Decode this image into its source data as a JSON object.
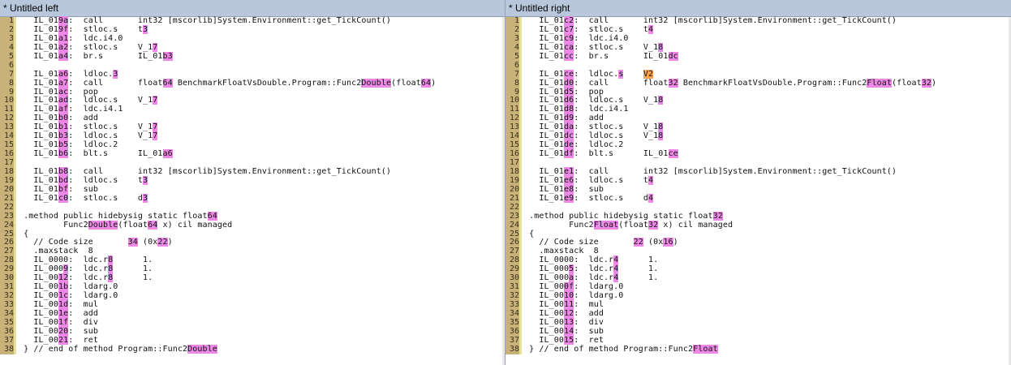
{
  "panes": [
    {
      "title": "* Untitled left",
      "lines": [
        [
          [
            "   IL_01",
            ""
          ],
          [
            "9a",
            "hl"
          ],
          [
            ":  call       int32 [mscorlib]System.Environment::get_TickCount()",
            ""
          ]
        ],
        [
          [
            "   IL_01",
            ""
          ],
          [
            "9f",
            "hl"
          ],
          [
            ":  stloc.s    t",
            ""
          ],
          [
            "3",
            "hl"
          ]
        ],
        [
          [
            "   IL_01",
            ""
          ],
          [
            "a1",
            "hl"
          ],
          [
            ":  ldc.i4.0",
            ""
          ]
        ],
        [
          [
            "   IL_01",
            ""
          ],
          [
            "a2",
            "hl"
          ],
          [
            ":  stloc.s    V_1",
            ""
          ],
          [
            "7",
            "hl"
          ]
        ],
        [
          [
            "   IL_01",
            ""
          ],
          [
            "a4",
            "hl"
          ],
          [
            ":  br.s       IL_01",
            ""
          ],
          [
            "b3",
            "hl"
          ]
        ],
        [
          [
            "",
            ""
          ]
        ],
        [
          [
            "   IL_01",
            ""
          ],
          [
            "a6",
            "hl"
          ],
          [
            ":  ldloc.",
            ""
          ],
          [
            "3",
            "hl"
          ]
        ],
        [
          [
            "   IL_01",
            ""
          ],
          [
            "a7",
            "hl"
          ],
          [
            ":  call       float",
            ""
          ],
          [
            "64",
            "hl"
          ],
          [
            " BenchmarkFloatVsDouble.Program::Func2",
            ""
          ],
          [
            "Double",
            "hl"
          ],
          [
            "(float",
            ""
          ],
          [
            "64",
            "hl"
          ],
          [
            ")",
            ""
          ]
        ],
        [
          [
            "   IL_01",
            ""
          ],
          [
            "ac",
            "hl"
          ],
          [
            ":  pop",
            ""
          ]
        ],
        [
          [
            "   IL_01",
            ""
          ],
          [
            "ad",
            "hl"
          ],
          [
            ":  ldloc.s    V_1",
            ""
          ],
          [
            "7",
            "hl"
          ]
        ],
        [
          [
            "   IL_01",
            ""
          ],
          [
            "af",
            "hl"
          ],
          [
            ":  ldc.i4.1",
            ""
          ]
        ],
        [
          [
            "   IL_01",
            ""
          ],
          [
            "b0",
            "hl"
          ],
          [
            ":  add",
            ""
          ]
        ],
        [
          [
            "   IL_01",
            ""
          ],
          [
            "b1",
            "hl"
          ],
          [
            ":  stloc.s    V_1",
            ""
          ],
          [
            "7",
            "hl"
          ]
        ],
        [
          [
            "   IL_01",
            ""
          ],
          [
            "b3",
            "hl"
          ],
          [
            ":  ldloc.s    V_1",
            ""
          ],
          [
            "7",
            "hl"
          ]
        ],
        [
          [
            "   IL_01",
            ""
          ],
          [
            "b5",
            "hl"
          ],
          [
            ":  ldloc.2",
            ""
          ]
        ],
        [
          [
            "   IL_01",
            ""
          ],
          [
            "b6",
            "hl"
          ],
          [
            ":  blt.s      IL_01",
            ""
          ],
          [
            "a6",
            "hl"
          ]
        ],
        [
          [
            "",
            ""
          ]
        ],
        [
          [
            "   IL_01",
            ""
          ],
          [
            "b8",
            "hl"
          ],
          [
            ":  call       int32 [mscorlib]System.Environment::get_TickCount()",
            ""
          ]
        ],
        [
          [
            "   IL_01",
            ""
          ],
          [
            "bd",
            "hl"
          ],
          [
            ":  ldloc.s    t",
            ""
          ],
          [
            "3",
            "hl"
          ]
        ],
        [
          [
            "   IL_01",
            ""
          ],
          [
            "bf",
            "hl"
          ],
          [
            ":  sub",
            ""
          ]
        ],
        [
          [
            "   IL_01",
            ""
          ],
          [
            "c0",
            "hl"
          ],
          [
            ":  stloc.s    d",
            ""
          ],
          [
            "3",
            "hl"
          ]
        ],
        [
          [
            "",
            ""
          ]
        ],
        [
          [
            " .method public hidebysig static float",
            ""
          ],
          [
            "64",
            "hl"
          ]
        ],
        [
          [
            "         Func2",
            ""
          ],
          [
            "Double",
            "hl"
          ],
          [
            "(float",
            ""
          ],
          [
            "64",
            "hl"
          ],
          [
            " x) cil managed",
            ""
          ]
        ],
        [
          [
            " {",
            ""
          ]
        ],
        [
          [
            "   // Code size       ",
            ""
          ],
          [
            "34",
            "hl"
          ],
          [
            " (0x",
            ""
          ],
          [
            "22",
            "hl"
          ],
          [
            ")",
            ""
          ]
        ],
        [
          [
            "   .maxstack  8",
            ""
          ]
        ],
        [
          [
            "   IL_0000:  ldc.r",
            ""
          ],
          [
            "8",
            "hl"
          ],
          [
            "      1.",
            ""
          ]
        ],
        [
          [
            "   IL_000",
            ""
          ],
          [
            "9",
            "hl"
          ],
          [
            ":  ldc.r",
            ""
          ],
          [
            "8",
            "hl"
          ],
          [
            "      1.",
            ""
          ]
        ],
        [
          [
            "   IL_00",
            ""
          ],
          [
            "12",
            "hl"
          ],
          [
            ":  ldc.r",
            ""
          ],
          [
            "8",
            "hl"
          ],
          [
            "      1.",
            ""
          ]
        ],
        [
          [
            "   IL_00",
            ""
          ],
          [
            "1b",
            "hl"
          ],
          [
            ":  ldarg.0",
            ""
          ]
        ],
        [
          [
            "   IL_00",
            ""
          ],
          [
            "1c",
            "hl"
          ],
          [
            ":  ldarg.0",
            ""
          ]
        ],
        [
          [
            "   IL_00",
            ""
          ],
          [
            "1d",
            "hl"
          ],
          [
            ":  mul",
            ""
          ]
        ],
        [
          [
            "   IL_00",
            ""
          ],
          [
            "1e",
            "hl"
          ],
          [
            ":  add",
            ""
          ]
        ],
        [
          [
            "   IL_00",
            ""
          ],
          [
            "1f",
            "hl"
          ],
          [
            ":  div",
            ""
          ]
        ],
        [
          [
            "   IL_00",
            ""
          ],
          [
            "20",
            "hl"
          ],
          [
            ":  sub",
            ""
          ]
        ],
        [
          [
            "   IL_00",
            ""
          ],
          [
            "21",
            "hl"
          ],
          [
            ":  ret",
            ""
          ]
        ],
        [
          [
            " } // end of method Program::Func2",
            ""
          ],
          [
            "Double",
            "hl"
          ]
        ]
      ]
    },
    {
      "title": "* Untitled right",
      "lines": [
        [
          [
            "   IL_01",
            ""
          ],
          [
            "c2",
            "hl"
          ],
          [
            ":  call       int32 [mscorlib]System.Environment::get_TickCount()",
            ""
          ]
        ],
        [
          [
            "   IL_01",
            ""
          ],
          [
            "c7",
            "hl"
          ],
          [
            ":  stloc.s    t",
            ""
          ],
          [
            "4",
            "hl"
          ]
        ],
        [
          [
            "   IL_01",
            ""
          ],
          [
            "c9",
            "hl"
          ],
          [
            ":  ldc.i4.0",
            ""
          ]
        ],
        [
          [
            "   IL_01",
            ""
          ],
          [
            "ca",
            "hl"
          ],
          [
            ":  stloc.s    V_1",
            ""
          ],
          [
            "8",
            "hl"
          ]
        ],
        [
          [
            "   IL_01",
            ""
          ],
          [
            "cc",
            "hl"
          ],
          [
            ":  br.s       IL_01",
            ""
          ],
          [
            "dc",
            "hl"
          ]
        ],
        [
          [
            "",
            ""
          ]
        ],
        [
          [
            "   IL_01",
            ""
          ],
          [
            "ce",
            "hl"
          ],
          [
            ":  ldloc.",
            ""
          ],
          [
            "s",
            "hl"
          ],
          [
            "    ",
            ""
          ],
          [
            "V2",
            "hl2"
          ]
        ],
        [
          [
            "   IL_01",
            ""
          ],
          [
            "d0",
            "hl"
          ],
          [
            ":  call       float",
            ""
          ],
          [
            "32",
            "hl"
          ],
          [
            " BenchmarkFloatVsDouble.Program::Func2",
            ""
          ],
          [
            "Float",
            "hl"
          ],
          [
            "(float",
            ""
          ],
          [
            "32",
            "hl"
          ],
          [
            ")",
            ""
          ]
        ],
        [
          [
            "   IL_01",
            ""
          ],
          [
            "d5",
            "hl"
          ],
          [
            ":  pop",
            ""
          ]
        ],
        [
          [
            "   IL_01",
            ""
          ],
          [
            "d6",
            "hl"
          ],
          [
            ":  ldloc.s    V_1",
            ""
          ],
          [
            "8",
            "hl"
          ]
        ],
        [
          [
            "   IL_01",
            ""
          ],
          [
            "d8",
            "hl"
          ],
          [
            ":  ldc.i4.1",
            ""
          ]
        ],
        [
          [
            "   IL_01",
            ""
          ],
          [
            "d9",
            "hl"
          ],
          [
            ":  add",
            ""
          ]
        ],
        [
          [
            "   IL_01",
            ""
          ],
          [
            "da",
            "hl"
          ],
          [
            ":  stloc.s    V_1",
            ""
          ],
          [
            "8",
            "hl"
          ]
        ],
        [
          [
            "   IL_01",
            ""
          ],
          [
            "dc",
            "hl"
          ],
          [
            ":  ldloc.s    V_1",
            ""
          ],
          [
            "8",
            "hl"
          ]
        ],
        [
          [
            "   IL_01",
            ""
          ],
          [
            "de",
            "hl"
          ],
          [
            ":  ldloc.2",
            ""
          ]
        ],
        [
          [
            "   IL_01",
            ""
          ],
          [
            "df",
            "hl"
          ],
          [
            ":  blt.s      IL_01",
            ""
          ],
          [
            "ce",
            "hl"
          ]
        ],
        [
          [
            "",
            ""
          ]
        ],
        [
          [
            "   IL_01",
            ""
          ],
          [
            "e1",
            "hl"
          ],
          [
            ":  call       int32 [mscorlib]System.Environment::get_TickCount()",
            ""
          ]
        ],
        [
          [
            "   IL_01",
            ""
          ],
          [
            "e6",
            "hl"
          ],
          [
            ":  ldloc.s    t",
            ""
          ],
          [
            "4",
            "hl"
          ]
        ],
        [
          [
            "   IL_01",
            ""
          ],
          [
            "e8",
            "hl"
          ],
          [
            ":  sub",
            ""
          ]
        ],
        [
          [
            "   IL_01",
            ""
          ],
          [
            "e9",
            "hl"
          ],
          [
            ":  stloc.s    d",
            ""
          ],
          [
            "4",
            "hl"
          ]
        ],
        [
          [
            "",
            ""
          ]
        ],
        [
          [
            " .method public hidebysig static float",
            ""
          ],
          [
            "32",
            "hl"
          ]
        ],
        [
          [
            "         Func2",
            ""
          ],
          [
            "Float",
            "hl"
          ],
          [
            "(float",
            ""
          ],
          [
            "32",
            "hl"
          ],
          [
            " x) cil managed",
            ""
          ]
        ],
        [
          [
            " {",
            ""
          ]
        ],
        [
          [
            "   // Code size       ",
            ""
          ],
          [
            "22",
            "hl"
          ],
          [
            " (0x",
            ""
          ],
          [
            "16",
            "hl"
          ],
          [
            ")",
            ""
          ]
        ],
        [
          [
            "   .maxstack  8",
            ""
          ]
        ],
        [
          [
            "   IL_0000:  ldc.r",
            ""
          ],
          [
            "4",
            "hl"
          ],
          [
            "      1.",
            ""
          ]
        ],
        [
          [
            "   IL_000",
            ""
          ],
          [
            "5",
            "hl"
          ],
          [
            ":  ldc.r",
            ""
          ],
          [
            "4",
            "hl"
          ],
          [
            "      1.",
            ""
          ]
        ],
        [
          [
            "   IL_000",
            ""
          ],
          [
            "a",
            "hl"
          ],
          [
            ":  ldc.r",
            ""
          ],
          [
            "4",
            "hl"
          ],
          [
            "      1.",
            ""
          ]
        ],
        [
          [
            "   IL_00",
            ""
          ],
          [
            "0f",
            "hl"
          ],
          [
            ":  ldarg.0",
            ""
          ]
        ],
        [
          [
            "   IL_00",
            ""
          ],
          [
            "10",
            "hl"
          ],
          [
            ":  ldarg.0",
            ""
          ]
        ],
        [
          [
            "   IL_00",
            ""
          ],
          [
            "11",
            "hl"
          ],
          [
            ":  mul",
            ""
          ]
        ],
        [
          [
            "   IL_00",
            ""
          ],
          [
            "12",
            "hl"
          ],
          [
            ":  add",
            ""
          ]
        ],
        [
          [
            "   IL_00",
            ""
          ],
          [
            "13",
            "hl"
          ],
          [
            ":  div",
            ""
          ]
        ],
        [
          [
            "   IL_00",
            ""
          ],
          [
            "14",
            "hl"
          ],
          [
            ":  sub",
            ""
          ]
        ],
        [
          [
            "   IL_00",
            ""
          ],
          [
            "15",
            "hl"
          ],
          [
            ":  ret",
            ""
          ]
        ],
        [
          [
            " } // end of method Program::Func2",
            ""
          ],
          [
            "Float",
            "hl"
          ]
        ]
      ]
    }
  ]
}
